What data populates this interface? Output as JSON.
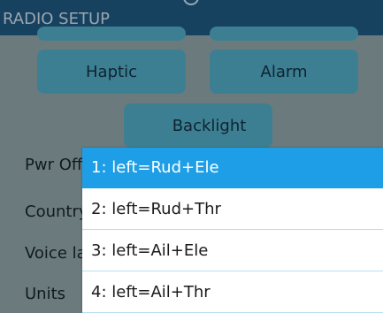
{
  "header": {
    "title": "RADIO SETUP"
  },
  "buttons": {
    "haptic": "Haptic",
    "alarm": "Alarm",
    "backlight": "Backlight"
  },
  "settings": {
    "pwr_off_label": "Pwr Off",
    "country_label": "Country",
    "voice_label": "Voice la",
    "units_label": "Units"
  },
  "dropdown": {
    "selected_index": 0,
    "options": [
      "1: left=Rud+Ele",
      "2: left=Rud+Thr",
      "3: left=Ail+Ele",
      "4: left=Ail+Thr"
    ]
  },
  "colors": {
    "header_bg": "#16415f",
    "screen_dimmed_bg": "#6b7b7d",
    "button_bg": "#3c7f92",
    "selected_option_bg": "#1e9ee6"
  }
}
